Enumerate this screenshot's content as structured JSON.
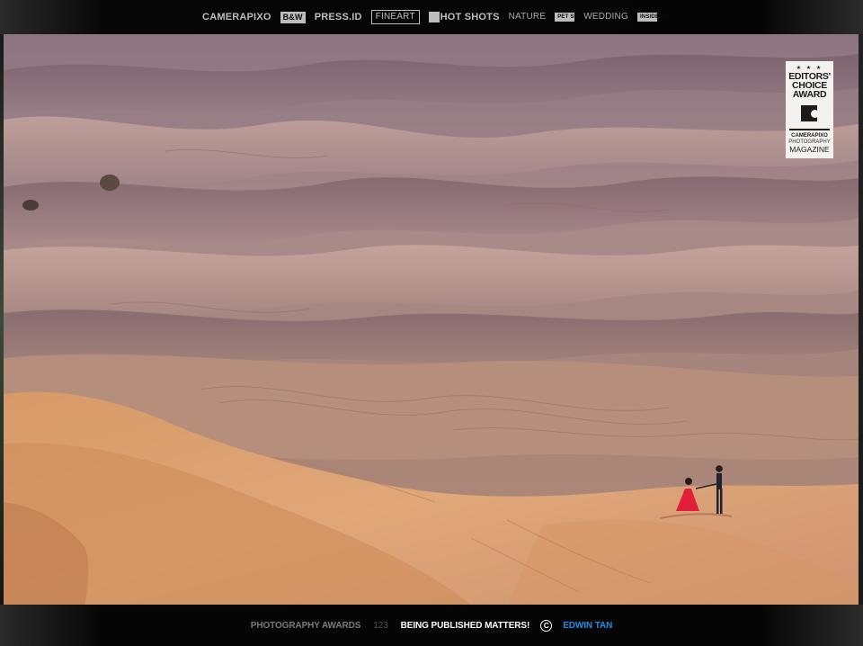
{
  "header": {
    "logos": [
      {
        "name": "camerapixo-logo",
        "text": "CAMERAPIXO"
      },
      {
        "name": "bw-logo",
        "text": "B&W"
      },
      {
        "name": "press-id-logo",
        "text": "PRESS.ID"
      },
      {
        "name": "fineart-logo",
        "text": "FINEART"
      },
      {
        "name": "hot-shots-logo",
        "text": "HOT SHOTS"
      },
      {
        "name": "nature-logo",
        "text": "NATURE"
      },
      {
        "name": "pet-logo",
        "text": "PET SHOTS"
      },
      {
        "name": "wedding-logo",
        "text": "WEDDING"
      },
      {
        "name": "inside-out-logo",
        "text": "INSIDE OUT"
      }
    ]
  },
  "photo": {
    "description": "",
    "colors": {
      "sky_dunes": "#9c7f86",
      "mid_dunes": "#b08c83",
      "front_dunes": "#dc9d69",
      "dress": "#e0203a"
    }
  },
  "award": {
    "stars": "★ ★ ★",
    "line1": "EDITORS'",
    "line2": "CHOICE",
    "line3": "AWARD",
    "brand": "CAMERAPIXO",
    "sub": "PHOTOGRAPHY",
    "magazine": "MAGAZINE"
  },
  "footer": {
    "awards": "PHOTOGRAPHY AWARDS",
    "number": "123",
    "tagline": "BEING PUBLISHED MATTERS!",
    "copyright_symbol": "C",
    "author": "EDWIN TAN",
    "author_color": "#1f8ee8"
  }
}
